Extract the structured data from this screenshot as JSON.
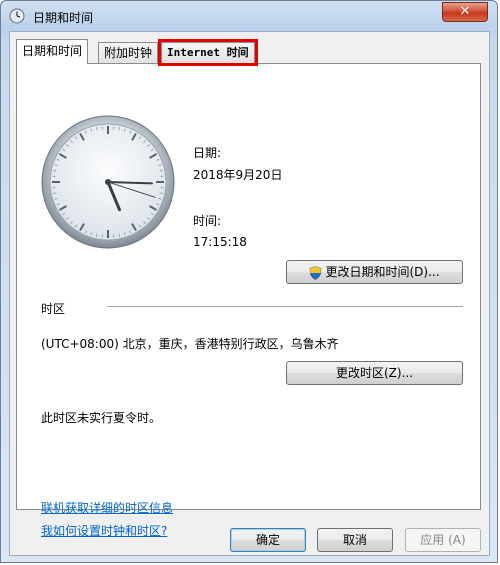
{
  "window": {
    "title": "日期和时间",
    "close_symbol": "✕"
  },
  "tabs": [
    {
      "label": "日期和时间",
      "active": true
    },
    {
      "label": "附加时钟",
      "active": false
    },
    {
      "label": "Internet 时间",
      "active": false,
      "highlighted": true
    }
  ],
  "date": {
    "label": "日期:",
    "value": "2018年9月20日"
  },
  "time": {
    "label": "时间:",
    "value": "17:15:18",
    "hour": 17,
    "minute": 15,
    "second": 18
  },
  "change_datetime_button": "更改日期和时间(D)...",
  "timezone": {
    "section_label": "时区",
    "value": "(UTC+08:00) 北京，重庆，香港特别行政区，乌鲁木齐",
    "change_button": "更改时区(Z)...",
    "dst_note": "此时区未实行夏令时。"
  },
  "links": {
    "online_info": "联机获取详细的时区信息",
    "how_to_set": "我如何设置时钟和时区?"
  },
  "footer": {
    "ok": "确定",
    "cancel": "取消",
    "apply": "应用 (A)"
  }
}
